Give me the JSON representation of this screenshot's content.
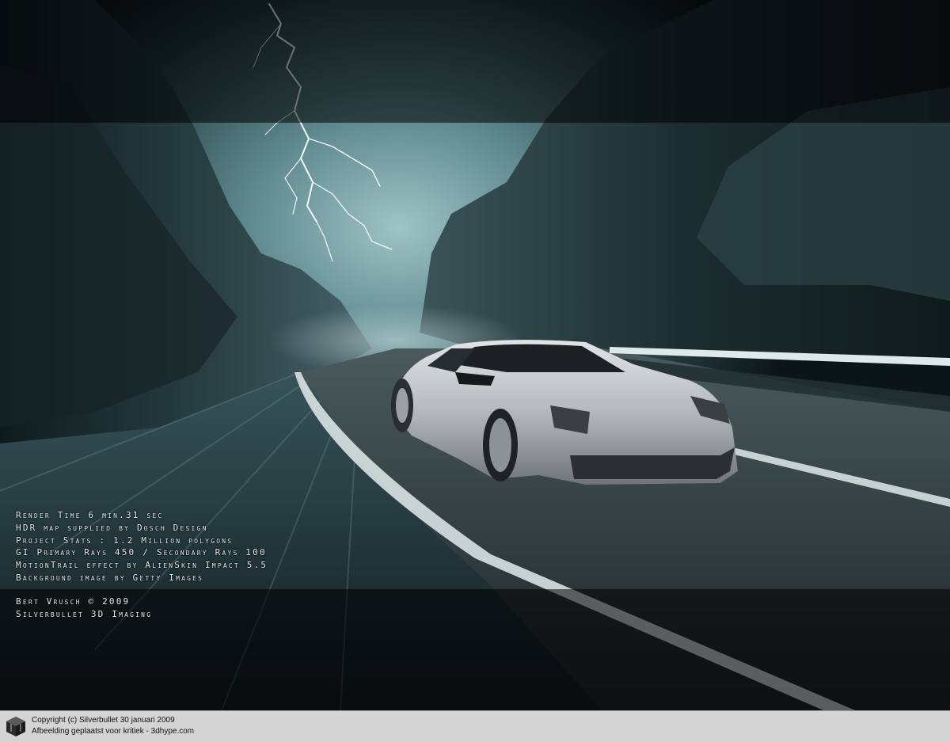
{
  "image": {
    "subject": "silver-sports-car-on-mountain-road",
    "colors": {
      "sky": "#5f8a90",
      "rock": "#1a2a2d",
      "road": "#2a3436",
      "car": "#b9bdc0",
      "text": "#e4ecee",
      "footer_bg": "#d4d4d4"
    }
  },
  "credits": {
    "render_time": "Render Time 6 min.31 sec",
    "hdr_map": "HDR map supplied by Dosch Design",
    "project_stats": "Project Stats : 1.2 Million polygons",
    "gi_rays": "GI Primary Rays 450 / Secondary Rays 100",
    "motion_trail": "MotionTrail effect by AlienSkin Impact 5.5",
    "background": "Background image by Getty Images",
    "author": "Bert Vrusch © 2009",
    "studio": "Silverbullet 3D Imaging"
  },
  "footer": {
    "logo_icon": "3d-cube-icon",
    "copyright": "Copyright (c) Silverbullet 30 januari 2009",
    "posted": "Afbeelding geplaatst voor kritiek - 3dhype.com"
  }
}
